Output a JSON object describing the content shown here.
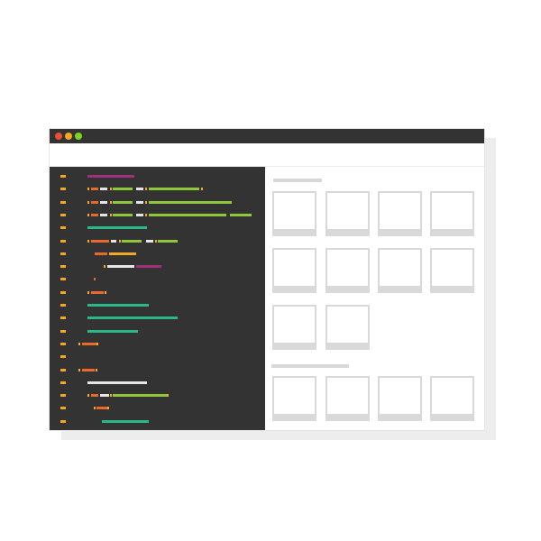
{
  "colors": {
    "titlebar": "#333333",
    "editor_background": "#333333",
    "dot_close": "#e94f37",
    "dot_minimize": "#f5a623",
    "dot_maximize": "#7ed321",
    "line_number": "#f5a623",
    "placeholder": "#d9d9d9"
  },
  "window": {
    "controls": [
      {
        "name": "close",
        "icon": "close-dot-icon"
      },
      {
        "name": "minimize",
        "icon": "minimize-dot-icon"
      },
      {
        "name": "maximize",
        "icon": "maximize-dot-icon"
      }
    ]
  },
  "editor": {
    "token_colors": {
      "purple": "#a0307a",
      "orange": "#e8692a",
      "white": "#e6e6e6",
      "green": "#8fc93a",
      "teal": "#2ab888",
      "amber": "#f5a623"
    }
  },
  "preview": {
    "sections": [
      {
        "rows": [
          4,
          4,
          2
        ]
      },
      {
        "rows": [
          4
        ]
      }
    ]
  }
}
